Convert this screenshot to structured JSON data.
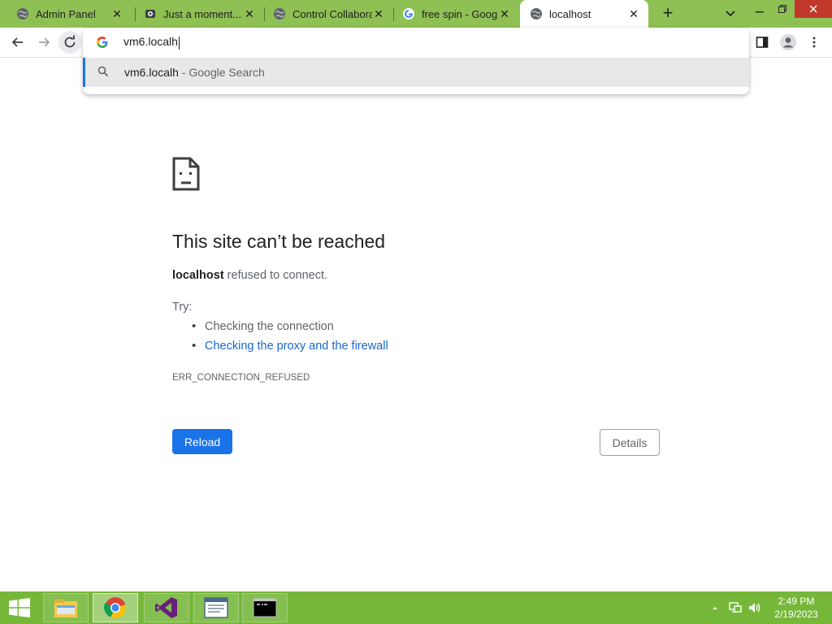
{
  "browser": {
    "tabs": [
      {
        "title": "Admin Panel",
        "favicon": "globe-icon",
        "active": false
      },
      {
        "title": "Just a moment...",
        "favicon": "cloudflare-icon",
        "active": false
      },
      {
        "title": "Control Collabora",
        "favicon": "globe-icon",
        "active": false
      },
      {
        "title": "free spin - Google",
        "favicon": "google-icon",
        "active": false
      },
      {
        "title": "localhost",
        "favicon": "globe-icon",
        "active": true
      }
    ],
    "new_tab_label": "+",
    "close_glyph": "✕"
  },
  "omnibox": {
    "value": "vm6.localh",
    "suggestion": {
      "text": "vm6.localh",
      "suffix": " - Google Search"
    }
  },
  "error_page": {
    "title": "This site can’t be reached",
    "host": "localhost",
    "desc_rest": " refused to connect.",
    "try_label": "Try:",
    "suggestions": [
      {
        "text": "Checking the connection",
        "link": false
      },
      {
        "text": "Checking the proxy and the firewall",
        "link": true
      }
    ],
    "error_code": "ERR_CONNECTION_REFUSED",
    "reload_label": "Reload",
    "details_label": "Details"
  },
  "taskbar": {
    "apps": [
      {
        "name": "file-explorer-icon"
      },
      {
        "name": "chrome-icon",
        "active": true
      },
      {
        "name": "visual-studio-icon"
      },
      {
        "name": "notepad-window-icon"
      },
      {
        "name": "command-prompt-icon"
      }
    ],
    "clock": {
      "time": "2:49 PM",
      "date": "2/19/2023"
    }
  },
  "colors": {
    "accent": "#1a73e8",
    "link": "#1967d2",
    "tabstrip": "#8fc054",
    "taskbar": "#76b73a"
  }
}
